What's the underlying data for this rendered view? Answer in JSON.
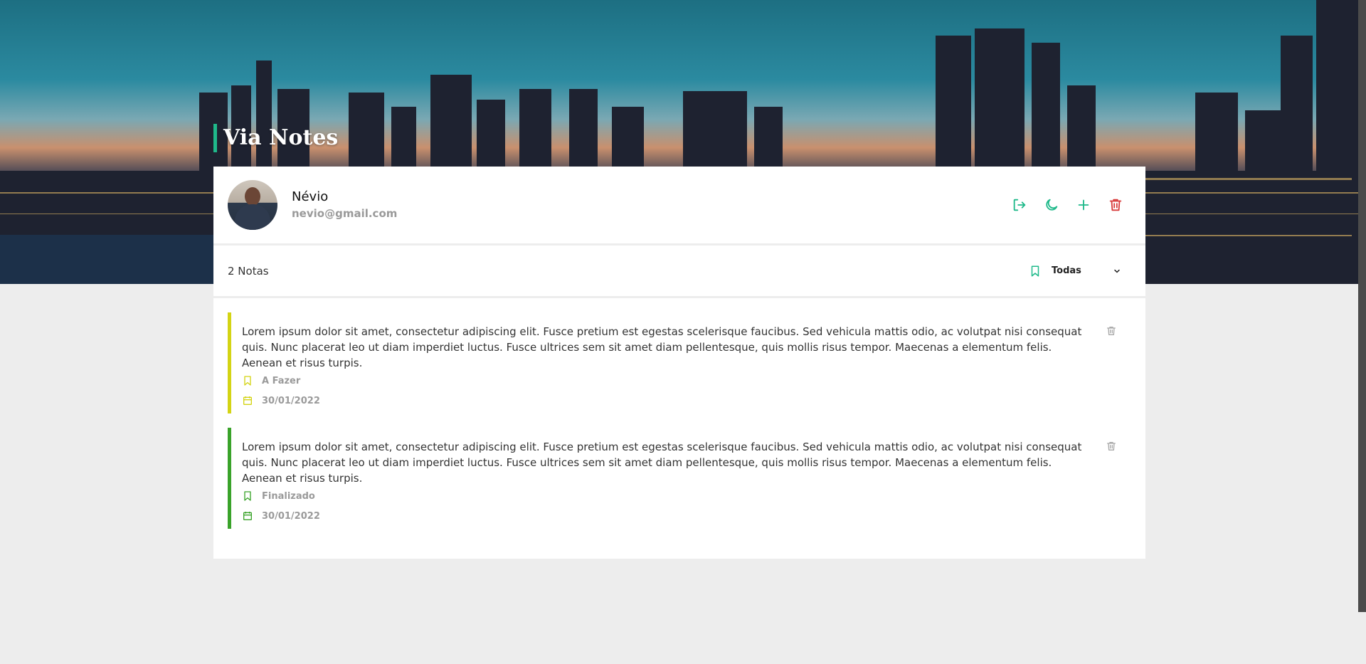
{
  "app": {
    "title": "Via Notes"
  },
  "user": {
    "name": "Névio",
    "email": "nevio@gmail.com"
  },
  "actions": [
    {
      "icon": "logout-icon",
      "color": "#1fb98a"
    },
    {
      "icon": "moon-icon",
      "color": "#1fb98a"
    },
    {
      "icon": "plus-icon",
      "color": "#1fb98a"
    },
    {
      "icon": "trash-icon",
      "color": "#d83b3b"
    }
  ],
  "toolbar": {
    "count_label": "2 Notas",
    "filter_label": "Todas"
  },
  "notes": [
    {
      "text": "Lorem ipsum dolor sit amet, consectetur adipiscing elit. Fusce pretium est egestas scelerisque faucibus. Sed vehicula mattis odio, ac volutpat nisi consequat quis. Nunc placerat leo ut diam imperdiet luctus. Fusce ultrices sem sit amet diam pellentesque, quis mollis risus tempor. Maecenas a elementum felis. Aenean et risus turpis.",
      "status": "A Fazer",
      "date": "30/01/2022",
      "color": "#d4d414"
    },
    {
      "text": "Lorem ipsum dolor sit amet, consectetur adipiscing elit. Fusce pretium est egestas scelerisque faucibus. Sed vehicula mattis odio, ac volutpat nisi consequat quis. Nunc placerat leo ut diam imperdiet luctus. Fusce ultrices sem sit amet diam pellentesque, quis mollis risus tempor. Maecenas a elementum felis. Aenean et risus turpis.",
      "status": "Finalizado",
      "date": "30/01/2022",
      "color": "#3aa32a"
    }
  ],
  "colors": {
    "accent": "#1fb98a",
    "danger": "#d83b3b",
    "background": "#ededed"
  }
}
